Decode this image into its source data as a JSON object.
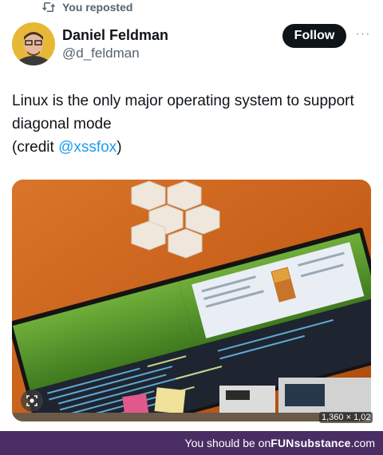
{
  "repost": {
    "label": "You reposted",
    "icon": "repost-icon"
  },
  "author": {
    "name": "Daniel Feldman",
    "handle": "@d_feldman",
    "follow_label": "Follow",
    "more_icon": "more-dots-icon",
    "more_label": "···"
  },
  "tweet": {
    "line1": "Linux is the only major operating system to support diagonal mode",
    "credit_prefix": "(credit ",
    "mention": "@xssfox",
    "credit_suffix": ")"
  },
  "media": {
    "dimensions": "1,360 × 1,02",
    "lens_icon": "visual-search-icon"
  },
  "footer": {
    "prefix": "You should be on ",
    "brand_bold": "FUNsubstance",
    "brand_suffix": ".com"
  },
  "colors": {
    "accent": "#1d9bf0",
    "follow_bg": "#0f1419",
    "footer_bg": "#4a2d63",
    "muted": "#536471"
  }
}
